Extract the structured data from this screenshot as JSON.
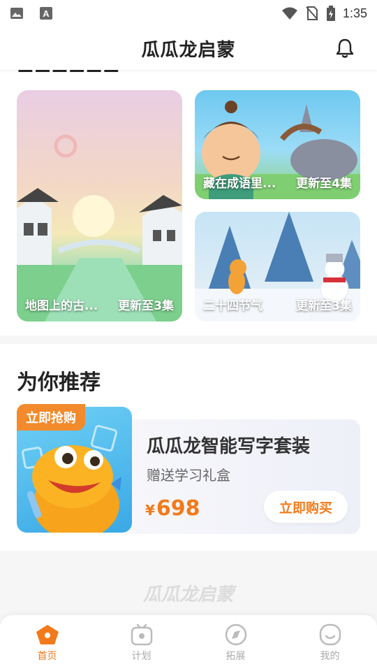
{
  "status_bar": {
    "time": "1:35"
  },
  "header": {
    "title": "瓜瓜龙启蒙"
  },
  "section1": {
    "cards": [
      {
        "title": "地图上的古...",
        "update": "更新至3集"
      },
      {
        "title": "藏在成语里...",
        "update": "更新至4集"
      },
      {
        "title": "二十四节气",
        "update": "更新至3集"
      }
    ]
  },
  "recommend": {
    "title": "为你推荐",
    "badge": "立即抢购",
    "product_name": "瓜瓜龙智能写字套装",
    "product_sub": "赠送学习礼盒",
    "currency": "¥",
    "price": "698",
    "buy_label": "立即购买"
  },
  "footer_logo": "瓜瓜龙启蒙",
  "bottom_nav": [
    {
      "label": "首页",
      "icon": "home-icon",
      "active": true
    },
    {
      "label": "计划",
      "icon": "tv-icon",
      "active": false
    },
    {
      "label": "拓展",
      "icon": "compass-icon",
      "active": false
    },
    {
      "label": "我的",
      "icon": "face-icon",
      "active": false
    }
  ],
  "colors": {
    "accent": "#f27a1a",
    "badge": "#f38a2b"
  }
}
